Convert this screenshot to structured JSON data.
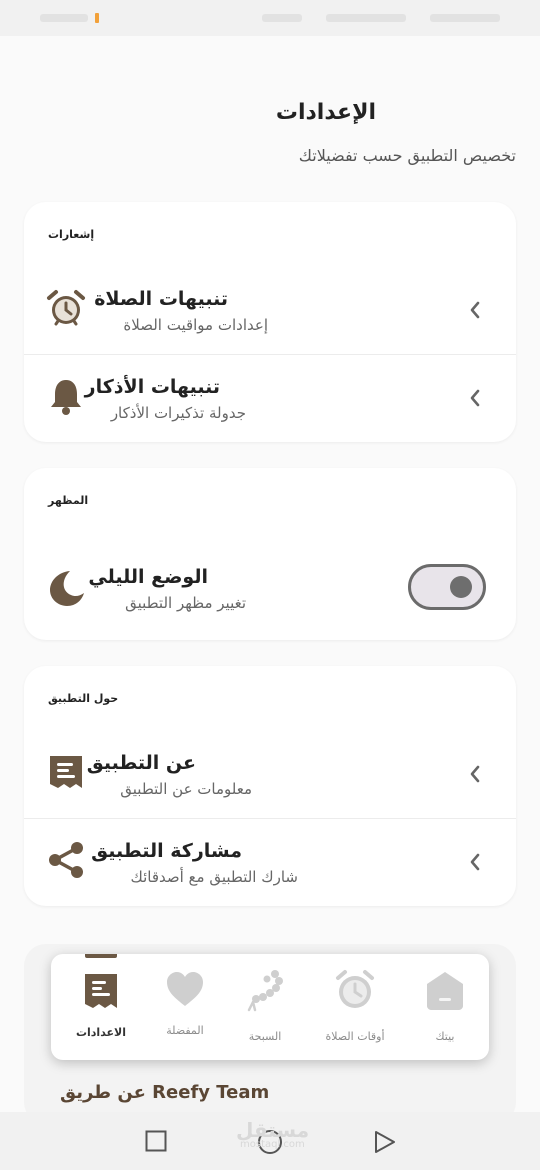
{
  "header": {
    "title": "الإعدادات",
    "subtitle": "تخصيص التطبيق حسب تفضيلاتك"
  },
  "notifications": {
    "section_label": "إشعارات",
    "items": [
      {
        "title": "تنبيهات الصلاة",
        "subtitle": "إعدادات مواقيت الصلاة",
        "icon": "alarm-clock-icon"
      },
      {
        "title": "تنبيهات الأذكار",
        "subtitle": "جدولة تذكيرات الأذكار",
        "icon": "bell-icon"
      }
    ]
  },
  "appearance": {
    "section_label": "المظهر",
    "dark_mode": {
      "title": "الوضع الليلي",
      "subtitle": "تغيير مظهر التطبيق",
      "icon": "moon-icon",
      "enabled": false
    }
  },
  "about": {
    "section_label": "حول التطبيق",
    "items": [
      {
        "title": "عن التطبيق",
        "subtitle": "معلومات عن التطبيق",
        "icon": "document-icon"
      },
      {
        "title": "مشاركة التطبيق",
        "subtitle": "شارك التطبيق مع أصدقائك",
        "icon": "share-icon"
      }
    ]
  },
  "credit": "عن طريق Reefy Team",
  "bottom_nav": {
    "items": [
      {
        "label": "بيتك",
        "icon": "home-icon",
        "active": false
      },
      {
        "label": "أوقات الصلاة",
        "icon": "clock-icon",
        "active": false
      },
      {
        "label": "السبحة",
        "icon": "prayer-beads-icon",
        "active": false
      },
      {
        "label": "المفضلة",
        "icon": "heart-icon",
        "active": false
      },
      {
        "label": "الاعدادات",
        "icon": "document-icon",
        "active": true
      }
    ]
  },
  "watermark": {
    "text": "مستقل",
    "sub": "mostaql.com"
  },
  "colors": {
    "accent": "#6b5844",
    "icon_inactive": "#cfcfcf",
    "background": "#fafafa",
    "card": "#ffffff"
  }
}
